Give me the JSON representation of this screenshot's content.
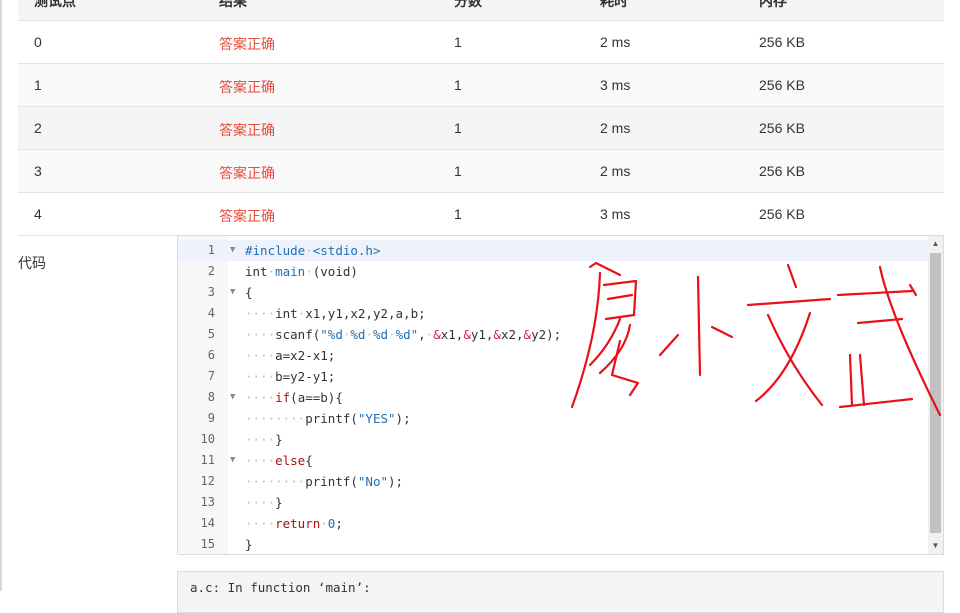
{
  "table": {
    "headers": [
      "测试点",
      "结果",
      "分数",
      "耗时",
      "内存"
    ],
    "rows": [
      {
        "point": "0",
        "result": "答案正确",
        "score": "1",
        "time": "2 ms",
        "memory": "256 KB"
      },
      {
        "point": "1",
        "result": "答案正确",
        "score": "1",
        "time": "3 ms",
        "memory": "256 KB"
      },
      {
        "point": "2",
        "result": "答案正确",
        "score": "1",
        "time": "2 ms",
        "memory": "256 KB"
      },
      {
        "point": "3",
        "result": "答案正确",
        "score": "1",
        "time": "2 ms",
        "memory": "256 KB"
      },
      {
        "point": "4",
        "result": "答案正确",
        "score": "1",
        "time": "3 ms",
        "memory": "256 KB"
      }
    ]
  },
  "code_section": {
    "label": "代码",
    "line_numbers": [
      "1",
      "2",
      "3",
      "4",
      "5",
      "6",
      "7",
      "8",
      "9",
      "10",
      "11",
      "12",
      "13",
      "14",
      "15"
    ]
  },
  "compile_output": {
    "text": "a.c: In function ‘main’:"
  },
  "annotation": {
    "handwriting_text": "廖小文武",
    "color": "#e8101a"
  },
  "colors": {
    "accepted": "#e74c3c",
    "keyword": "#a31515",
    "identifier": "#1f6fb5"
  }
}
